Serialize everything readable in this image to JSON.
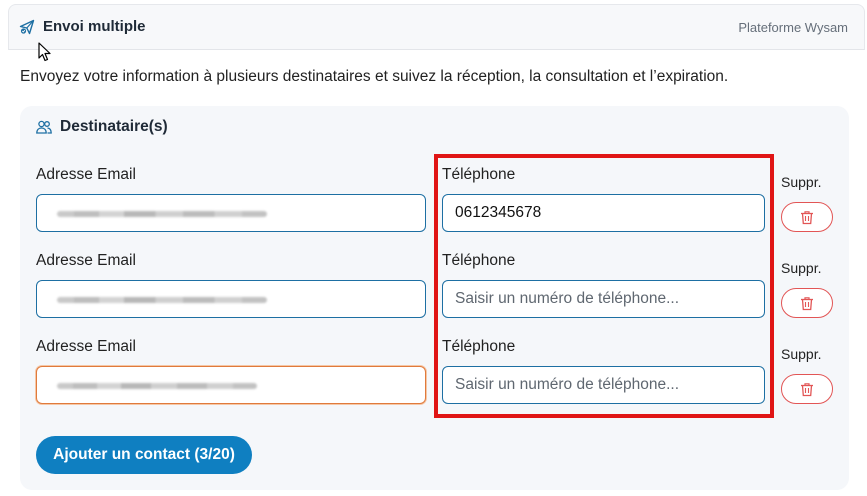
{
  "header": {
    "title": "Envoi multiple",
    "platform": "Plateforme Wysam"
  },
  "intro": "Envoyez votre information à plusieurs destinataires et suivez la réception, la consultation et l’expiration.",
  "recipients": {
    "title": "Destinataire(s)",
    "email_label": "Adresse Email",
    "phone_label": "Téléphone",
    "delete_label": "Suppr.",
    "phone_placeholder": "Saisir un numéro de téléphone...",
    "rows": [
      {
        "phone": "0612345678"
      },
      {
        "phone": ""
      },
      {
        "phone": ""
      }
    ]
  },
  "add_button": "Ajouter un contact (3/20)",
  "colors": {
    "accent": "#0f7fc1",
    "input_border": "#1d6fa3",
    "delete": "#e25555",
    "highlight": "#e01515"
  }
}
